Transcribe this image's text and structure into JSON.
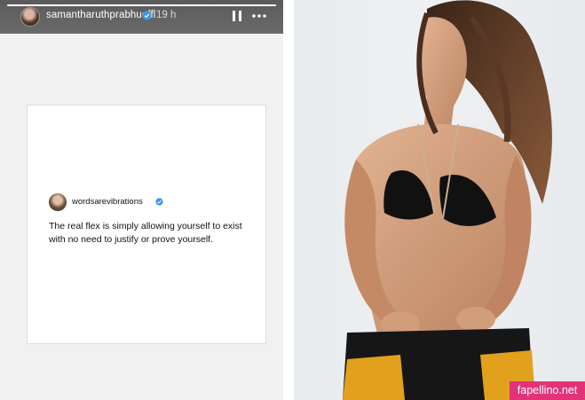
{
  "story": {
    "progress": 1.0,
    "username": "samantharuthprabhuoffl",
    "time_ago": "19 h",
    "icons": {
      "verified": "verified-badge-icon",
      "pause": "pause-icon",
      "more": "more-options-icon"
    },
    "shared_post": {
      "handle": "wordsarevibrations",
      "text": "The real flex is simply allowing yourself to exist with no need to justify or prove yourself."
    }
  },
  "photo": {
    "description_icon": "portrait-photo"
  },
  "watermark": {
    "site": "fapellino.net"
  },
  "colors": {
    "verified_blue": "#3897f0",
    "watermark_pink": "#e2337a"
  }
}
